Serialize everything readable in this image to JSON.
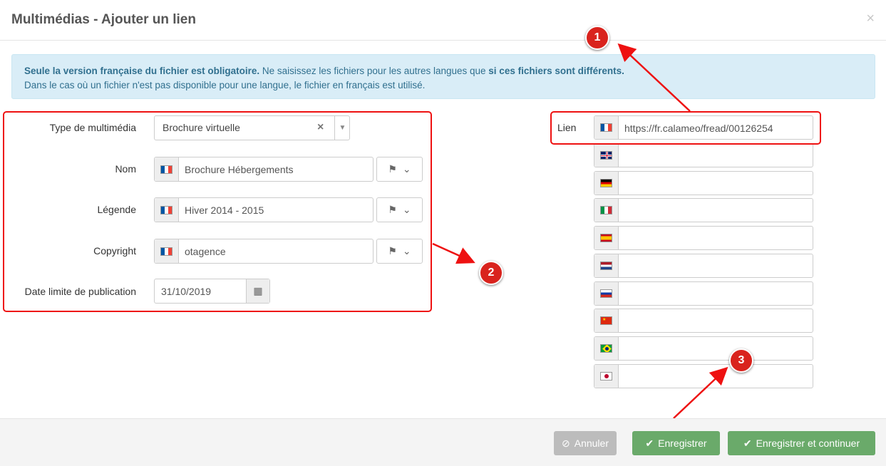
{
  "modal": {
    "title": "Multimédias - Ajouter un lien",
    "close": "×"
  },
  "alert": {
    "line1_bold": "Seule la version française du fichier est obligatoire.",
    "line1_text": " Ne saisissez les fichiers pour les autres langues que ",
    "line1_bold2": "si ces fichiers sont différents.",
    "line2": "Dans le cas où un fichier n'est pas disponible pour une langue, le fichier en français est utilisé."
  },
  "form": {
    "type_label": "Type de multimédia",
    "type_value": "Brochure virtuelle",
    "nom_label": "Nom",
    "nom_value": "Brochure Hébergements",
    "legende_label": "Légende",
    "legende_value": "Hiver 2014 - 2015",
    "copyright_label": "Copyright",
    "copyright_value": "otagence",
    "date_label": "Date limite de publication",
    "date_value": "31/10/2019"
  },
  "lien": {
    "label": "Lien",
    "fr_value": "https://fr.calameo/fread/00126254",
    "languages": [
      "gb",
      "de",
      "it",
      "es",
      "nl",
      "ru",
      "cn",
      "br",
      "jp"
    ]
  },
  "annotations": [
    "1",
    "2",
    "3"
  ],
  "footer": {
    "cancel": "Annuler",
    "save": "Enregistrer",
    "save_continue": "Enregistrer et continuer"
  },
  "colors": {
    "accent_red": "#d9231d",
    "save_green": "#6aaa6a",
    "alert_bg": "#d9edf7"
  }
}
